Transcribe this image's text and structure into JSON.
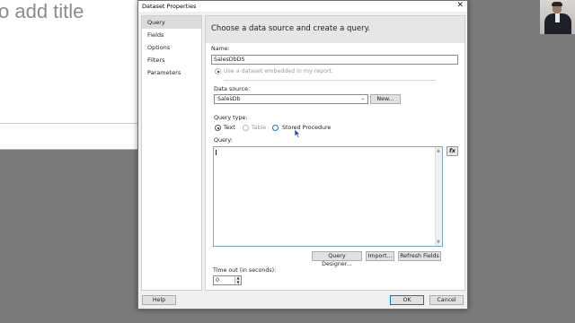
{
  "background_slide": {
    "title": "o add title"
  },
  "dialog": {
    "title": "Dataset Properties",
    "close_glyph": "✕",
    "nav": [
      "Query",
      "Fields",
      "Options",
      "Filters",
      "Parameters"
    ],
    "header": "Choose a data source and create a query.",
    "name_label": "Name:",
    "name_value": "SalesDbDS",
    "embedded_option": "Use a dataset embedded in my report.",
    "datasource_label": "Data source:",
    "datasource_value": "SalesDb",
    "new_button": "New...",
    "querytype_label": "Query type:",
    "querytype_options": [
      "Text",
      "Table",
      "Stored Procedure"
    ],
    "query_label": "Query:",
    "fx_button": "fx",
    "query_designer_button": "Query Designer...",
    "import_button": "Import...",
    "refresh_button": "Refresh Fields",
    "timeout_label": "Time out (in seconds):",
    "timeout_value": "0",
    "help_button": "Help",
    "ok_button": "OK",
    "cancel_button": "Cancel"
  },
  "colors": {
    "accent": "#0078d7",
    "header_bg": "#e6e6e6",
    "desktop": "#7a7a7a"
  },
  "icons": {
    "close": "close-icon",
    "dropdown": "chevron-down-icon",
    "function": "fx-icon",
    "spin": "spin-arrows-icon",
    "pointer": "mouse-pointer-icon"
  }
}
